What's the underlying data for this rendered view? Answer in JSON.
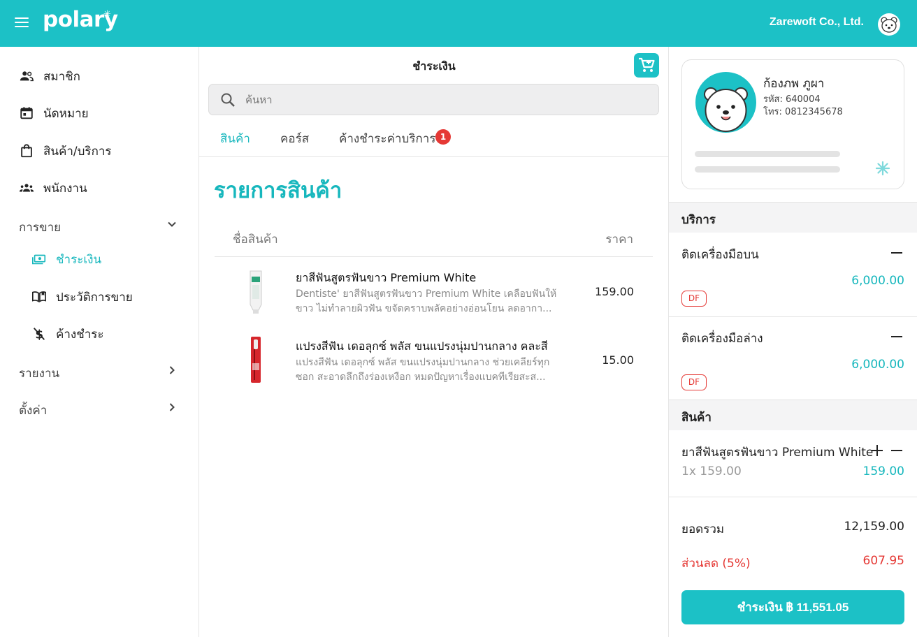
{
  "header": {
    "logo": "polary",
    "company": "Zarewoft Co., Ltd.",
    "brand_color": "#1cc1c6"
  },
  "sidebar": {
    "items": [
      {
        "label": "สมาชิก",
        "icon": "members-icon"
      },
      {
        "label": "นัดหมาย",
        "icon": "calendar-icon"
      },
      {
        "label": "สินค้า/บริการ",
        "icon": "shopping-bag-icon"
      },
      {
        "label": "พนักงาน",
        "icon": "staff-icon"
      }
    ],
    "sales_group": "การขาย",
    "sales_items": [
      {
        "label": "ชำระเงิน",
        "icon": "cash-icon",
        "active": true
      },
      {
        "label": "ประวัติการขาย",
        "icon": "book-icon"
      },
      {
        "label": "ค้างชำระ",
        "icon": "no-money-icon"
      }
    ],
    "report_group": "รายงาน",
    "settings_group": "ตั้งค่า"
  },
  "main": {
    "title": "ชำระเงิน",
    "search_placeholder": "ค้นหา",
    "tabs": [
      {
        "label": "สินค้า",
        "active": true
      },
      {
        "label": "คอร์ส"
      },
      {
        "label": "ค้างชำระค่าบริการ",
        "badge": "1"
      }
    ],
    "section_title": "รายการสินค้า",
    "col_name": "ชื่อสินค้า",
    "col_price": "ราคา",
    "products": [
      {
        "name": "ยาสีฟันสูตรฟันขาว Premium White",
        "description": "Dentiste' ยาสีฟันสูตรฟันขาว Premium White เคลือบฟันให้ขาว ไม่ทำลายผิวฟัน ขจัดคราบพลัคอย่างอ่อนโยน ลดอากา...",
        "price": "159.00"
      },
      {
        "name": "แปรงสีฟัน เดอลุกซ์ พลัส ขนแปรงนุ่มปานกลาง คละสี",
        "description": "แปรงสีฟัน เดอลุกซ์ พลัส ขนแปรงนุ่มปานกลาง ช่วยเคลียร์ทุกซอก สะอาดลึกถึงร่องเหงือก หมดปัญหาเรื่องแบคทีเรียสะส...",
        "price": "15.00"
      }
    ]
  },
  "cart": {
    "member": {
      "name": "ก้องภพ ภูผา",
      "code": "รหัส: 640004",
      "phone": "โทร: 0812345678"
    },
    "services_title": "บริการ",
    "services": [
      {
        "name": "ติดเครื่องมือบน",
        "price": "6,000.00",
        "tag": "DF"
      },
      {
        "name": "ติดเครื่องมือล่าง",
        "price": "6,000.00",
        "tag": "DF"
      }
    ],
    "products_title": "สินค้า",
    "products": [
      {
        "name": "ยาสีฟันสูตรฟันขาว Premium White",
        "qty": "1x 159.00",
        "price": "159.00"
      }
    ],
    "subtotal_label": "ยอดรวม",
    "subtotal": "12,159.00",
    "discount_label": "ส่วนลด (5%)",
    "discount": "607.95",
    "pay_label": "ชำระเงิน ฿ 11,551.05"
  }
}
